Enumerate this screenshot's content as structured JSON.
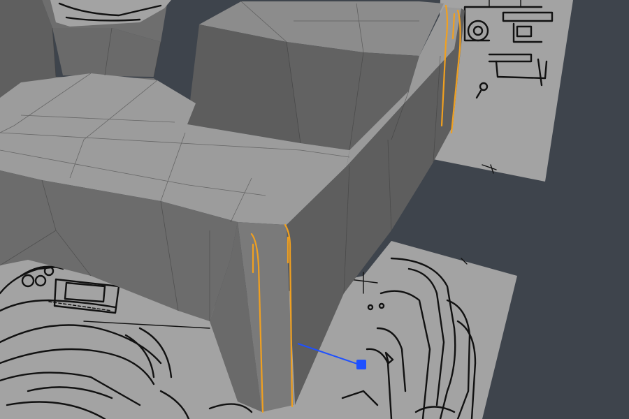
{
  "viewport": {
    "background_color": "#3e444c",
    "blueprint_color": "#a3a3a3",
    "blueprint_line_color": "#111111",
    "mesh_top_color": "#9e9e9e",
    "mesh_side_color": "#7a7a7a",
    "mesh_dark_color": "#5c5c5c",
    "selection_color": "#f0a020",
    "gizmo_color": "#1e50ff",
    "gizmo_axis": "x",
    "gizmo_icon": "move-arrow-icon",
    "selected_edge_count": 4
  }
}
